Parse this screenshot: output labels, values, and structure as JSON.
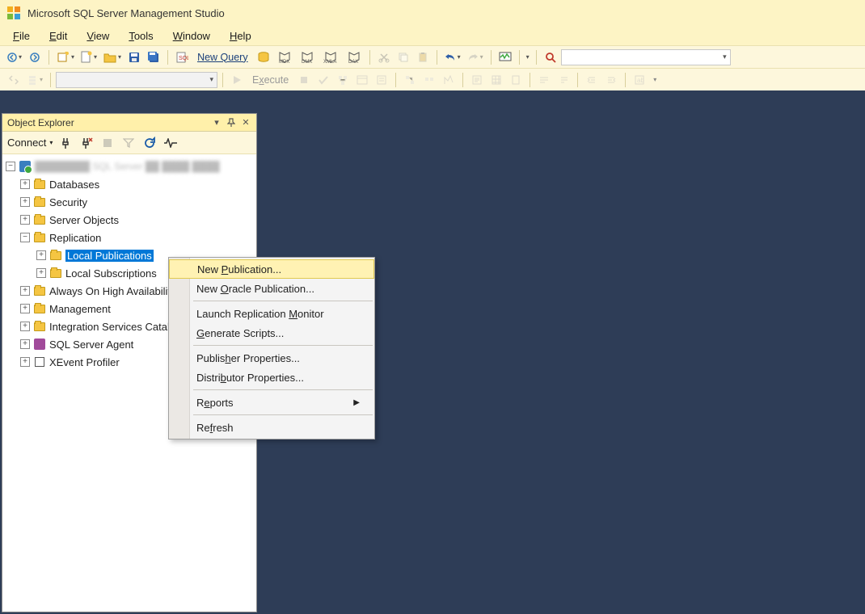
{
  "title": "Microsoft SQL Server Management Studio",
  "menu": {
    "file": "File",
    "edit": "Edit",
    "view": "View",
    "tools": "Tools",
    "window": "Window",
    "help": "Help"
  },
  "toolbar1": {
    "new_query": "New Query",
    "mdx": "MDX",
    "dmx": "DMX",
    "xmla": "XMLA",
    "dax": "DAX"
  },
  "toolbar2": {
    "execute": "Execute"
  },
  "object_explorer": {
    "title": "Object Explorer",
    "connect": "Connect",
    "server_blurred": "(server name redacted)",
    "nodes": {
      "databases": "Databases",
      "security": "Security",
      "server_objects": "Server Objects",
      "replication": "Replication",
      "local_publications": "Local Publications",
      "local_subscriptions": "Local Subscriptions",
      "always_on": "Always On High Availability",
      "management": "Management",
      "integration": "Integration Services Catalogs",
      "sql_agent": "SQL Server Agent",
      "xevent": "XEvent Profiler"
    }
  },
  "context_menu": {
    "new_publication": "New Publication...",
    "new_oracle_publication": "New Oracle Publication...",
    "launch_monitor": "Launch Replication Monitor",
    "generate_scripts": "Generate Scripts...",
    "publisher_properties": "Publisher Properties...",
    "distributor_properties": "Distributor Properties...",
    "reports": "Reports",
    "refresh": "Refresh"
  }
}
